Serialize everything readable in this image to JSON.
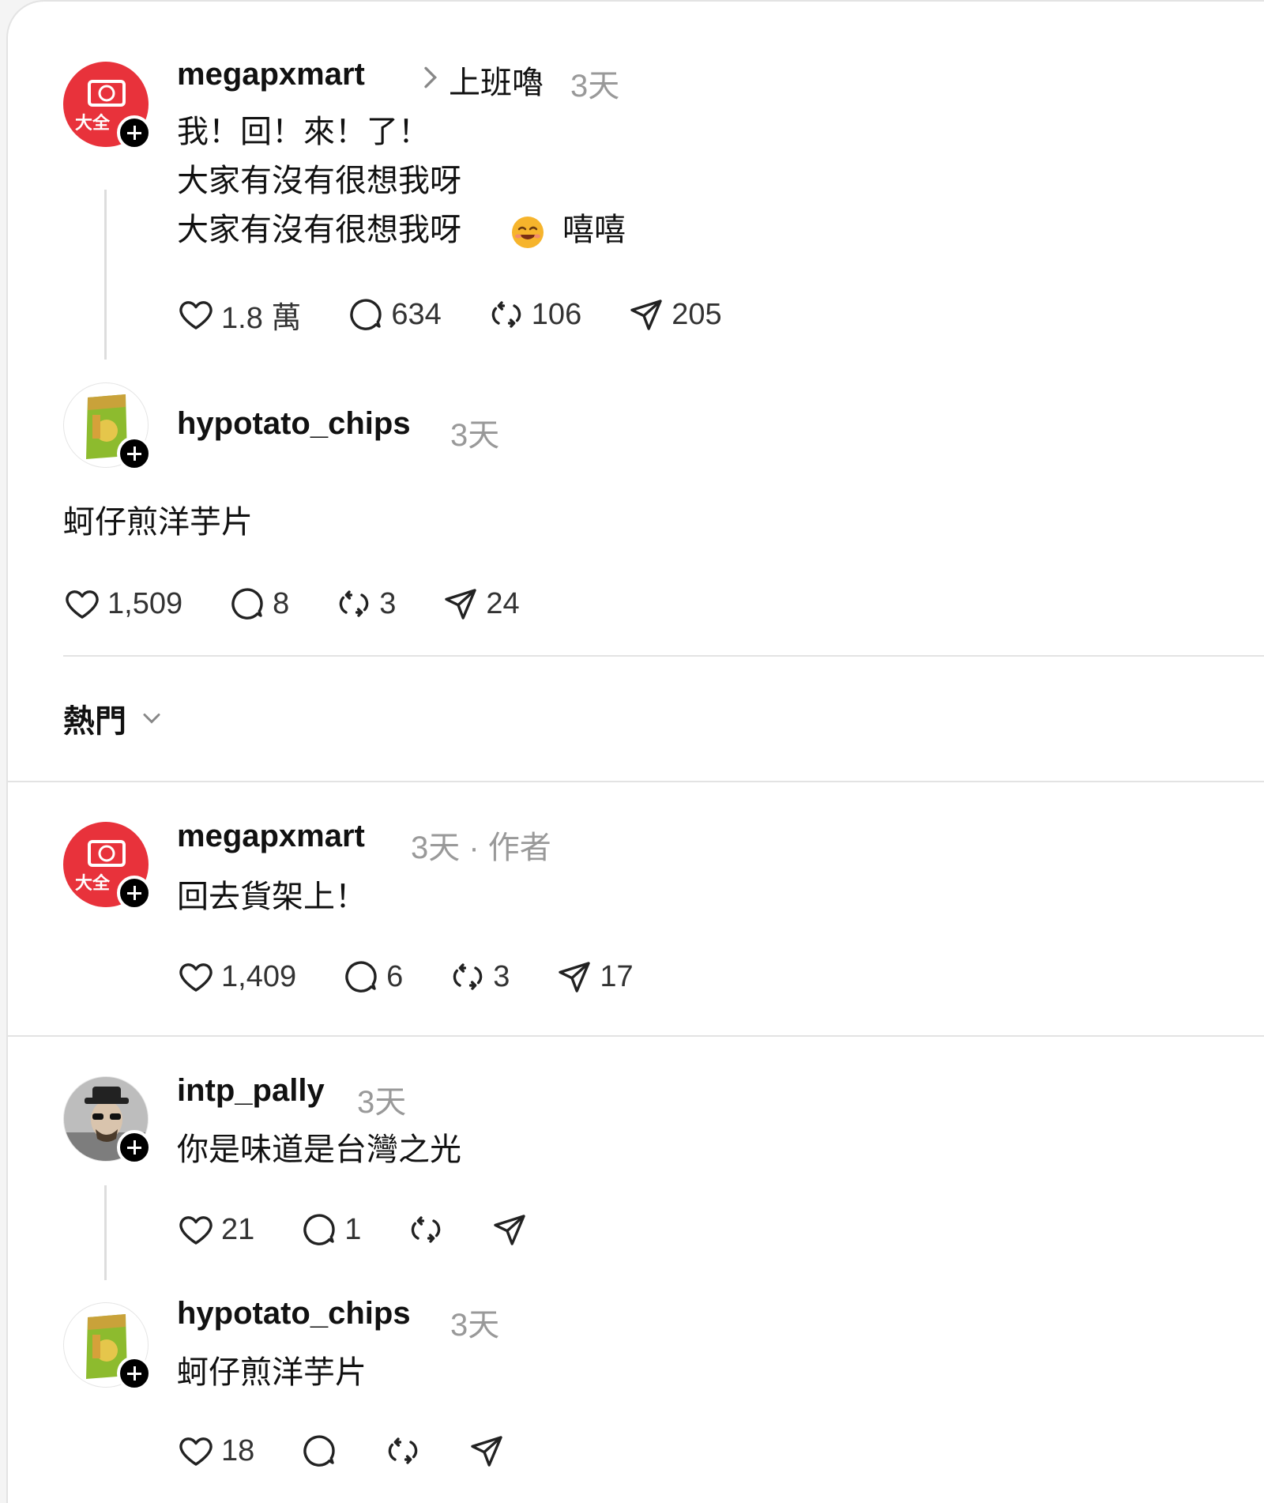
{
  "post": {
    "username": "megapxmart",
    "topic": "上班嚕",
    "time": "3天",
    "lines": [
      "我！回！來！了！",
      "大家有沒有很想我呀",
      "嘻嘻"
    ],
    "likes": "1.8 萬",
    "comments": "634",
    "reposts": "106",
    "shares": "205",
    "avatar_text": "大全"
  },
  "quoted": {
    "username": "hypotato_chips",
    "time": "3天",
    "text": "蚵仔煎洋芋片",
    "likes": "1,509",
    "comments": "8",
    "reposts": "3",
    "shares": "24"
  },
  "sort": {
    "label": "熱門"
  },
  "replies": [
    {
      "username": "megapxmart",
      "time": "3天",
      "tag": "作者",
      "text": "回去貨架上！",
      "likes": "1,409",
      "comments": "6",
      "reposts": "3",
      "shares": "17"
    },
    {
      "username": "intp_pally",
      "time": "3天",
      "text": "你是味道是台灣之光",
      "likes": "21",
      "comments": "1"
    },
    {
      "username": "hypotato_chips",
      "time": "3天",
      "text": "蚵仔煎洋芋片",
      "likes": "18"
    }
  ],
  "colors": {
    "brand_red": "#e8323b",
    "text": "#111111",
    "muted": "#999999"
  }
}
